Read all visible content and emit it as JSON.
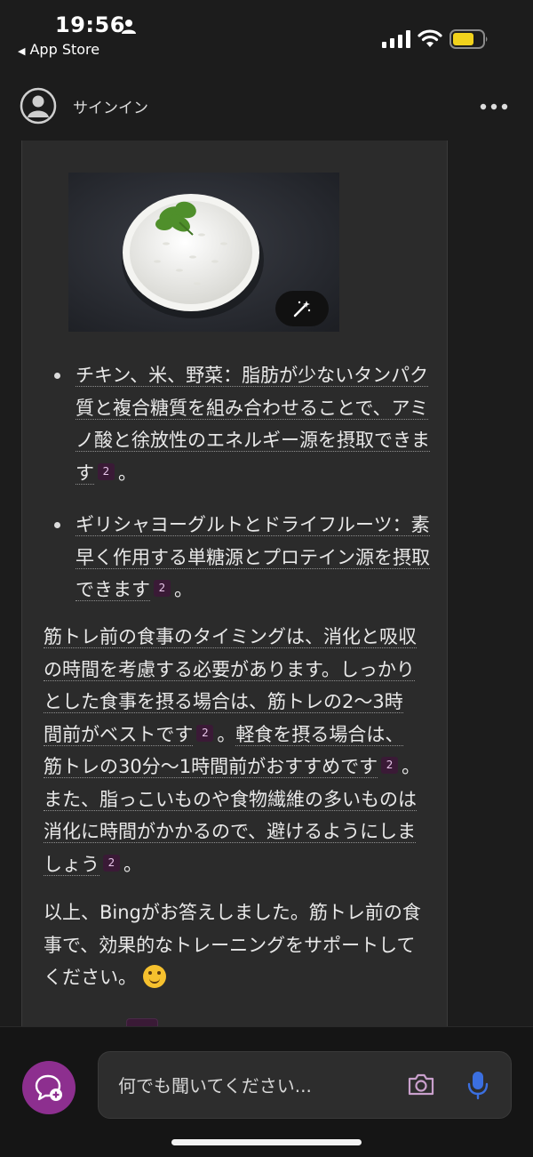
{
  "status_bar": {
    "time": "19:56",
    "back_app_label": "App Store",
    "icons": [
      "person-icon",
      "signal-icon",
      "wifi-icon",
      "battery-icon"
    ],
    "battery_color": "#f1d21c"
  },
  "header": {
    "signin_label": "サインイン",
    "more_icon": "more-icon"
  },
  "chat": {
    "bullets": [
      {
        "text": "チキン、米、野菜：脂肪が少ないタンパク質と複合糖質を組み合わせることで、アミノ酸と徐放性のエネルギー源を摂取できます",
        "ref": "2",
        "tail": "。"
      },
      {
        "text": "ギリシャヨーグルトとドライフルーツ：素早く作用する単糖源とプロテイン源を摂取できます",
        "ref": "2",
        "tail": "。"
      }
    ],
    "paragraph1": [
      {
        "text": "筋トレ前の食事のタイミングは、消化と吸収の時間を考慮する必要があります。しっかりとした食事を摂る場合は、筋トレの2〜3時間前がベストです",
        "ref": "2",
        "tail": "。"
      },
      {
        "text": "軽食を摂る場合は、筋トレの30分〜1時間前がおすすめです",
        "ref": "2",
        "tail": "。"
      },
      {
        "text": "また、脂っこいものや食物繊維の多いものは消化に時間がかかるので、避けるようにしましょう",
        "ref": "2",
        "tail": "。"
      }
    ],
    "paragraph2": "以上、Bingがお答えしました。筋トレ前の食事で、効果的なトレーニングをサポートしてください。",
    "emoji": "smiling-face-emoji"
  },
  "input": {
    "placeholder": "何でも聞いてください...",
    "icons": [
      "new-chat-icon",
      "camera-icon",
      "mic-icon"
    ]
  },
  "colors": {
    "background": "#1c1c1c",
    "card": "#2b2b2b",
    "accent_purple": "#8d2f8f",
    "ref_badge": "#3a1a36",
    "mic_blue": "#3b6fe0"
  }
}
